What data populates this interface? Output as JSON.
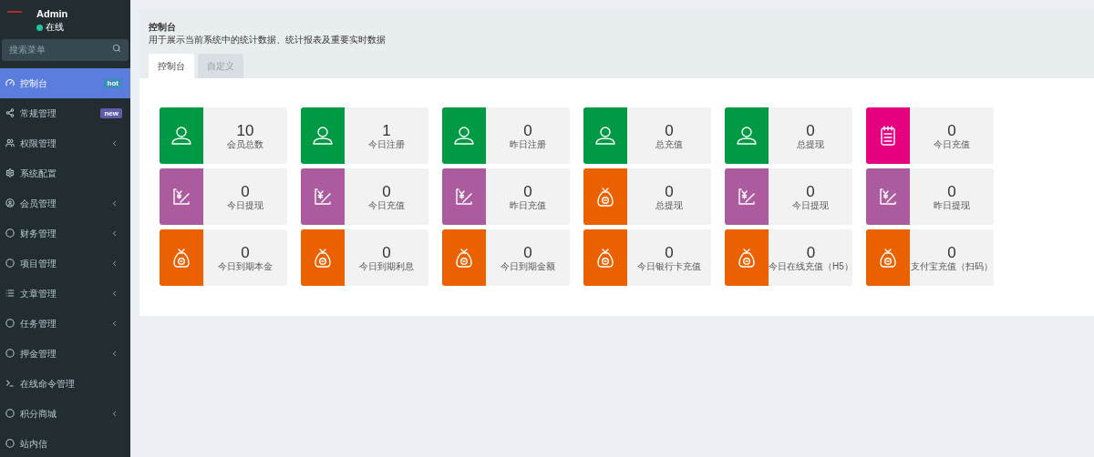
{
  "user": {
    "name": "Admin",
    "status": "在线"
  },
  "search": {
    "placeholder": "搜索菜单"
  },
  "menu": [
    {
      "label": "控制台",
      "kind": "dashboard",
      "selected": true,
      "badge": {
        "text": "hot",
        "color": "#3c8dbc"
      },
      "has_submenu": false
    },
    {
      "label": "常规管理",
      "kind": "cogs",
      "selected": false,
      "badge": {
        "text": "new",
        "color": "#605ca8"
      },
      "has_submenu": false
    },
    {
      "label": "权限管理",
      "kind": "group",
      "selected": false,
      "has_submenu": true
    },
    {
      "label": "系统配置",
      "kind": "gear",
      "selected": false,
      "has_submenu": false
    },
    {
      "label": "会员管理",
      "kind": "user",
      "selected": false,
      "has_submenu": true
    },
    {
      "label": "财务管理",
      "kind": "circle",
      "selected": false,
      "has_submenu": true
    },
    {
      "label": "项目管理",
      "kind": "circle",
      "selected": false,
      "has_submenu": true
    },
    {
      "label": "文章管理",
      "kind": "list",
      "selected": false,
      "has_submenu": true
    },
    {
      "label": "任务管理",
      "kind": "circle",
      "selected": false,
      "has_submenu": true
    },
    {
      "label": "押金管理",
      "kind": "circle",
      "selected": false,
      "has_submenu": true
    },
    {
      "label": "在线命令管理",
      "kind": "terminal",
      "selected": false,
      "has_submenu": false
    },
    {
      "label": "积分商城",
      "kind": "circle",
      "selected": false,
      "has_submenu": true
    },
    {
      "label": "站内信",
      "kind": "circle",
      "selected": false,
      "has_submenu": false
    }
  ],
  "header": {
    "title": "控制台",
    "subtitle": "用于展示当前系统中的统计数据、统计报表及重要实时数据"
  },
  "tabs": [
    {
      "label": "控制台",
      "selected": true
    },
    {
      "label": "自定义",
      "selected": false
    }
  ],
  "stats": [
    {
      "value": "10",
      "label": "会员总数",
      "kind": "user",
      "color": "#009a45"
    },
    {
      "value": "1",
      "label": "今日注册",
      "kind": "user",
      "color": "#009a45"
    },
    {
      "value": "0",
      "label": "昨日注册",
      "kind": "user",
      "color": "#009a45"
    },
    {
      "value": "0",
      "label": "总充值",
      "kind": "user",
      "color": "#009a45"
    },
    {
      "value": "0",
      "label": "总提现",
      "kind": "user",
      "color": "#009a45"
    },
    {
      "value": "0",
      "label": "今日充值",
      "kind": "notepad",
      "color": "#e4007f"
    },
    {
      "value": "0",
      "label": "今日提现",
      "kind": "yuan",
      "color": "#ac5b9e"
    },
    {
      "value": "0",
      "label": "今日充值",
      "kind": "yuan",
      "color": "#ac5b9e"
    },
    {
      "value": "0",
      "label": "昨日充值",
      "kind": "yuan",
      "color": "#ac5b9e"
    },
    {
      "value": "0",
      "label": "总提现",
      "kind": "bag",
      "color": "#eb6100"
    },
    {
      "value": "0",
      "label": "今日提现",
      "kind": "yuan",
      "color": "#ac5b9e"
    },
    {
      "value": "0",
      "label": "昨日提现",
      "kind": "yuan",
      "color": "#ac5b9e"
    },
    {
      "value": "0",
      "label": "今日到期本金",
      "kind": "bag",
      "color": "#eb6100"
    },
    {
      "value": "0",
      "label": "今日到期利息",
      "kind": "bag",
      "color": "#eb6100"
    },
    {
      "value": "0",
      "label": "今日到期金额",
      "kind": "bag",
      "color": "#eb6100"
    },
    {
      "value": "0",
      "label": "今日银行卡充值",
      "kind": "bag",
      "color": "#eb6100"
    },
    {
      "value": "0",
      "label": "今日在线充值（H5）",
      "kind": "bag",
      "color": "#eb6100"
    },
    {
      "value": "0",
      "label": "支付宝充值（扫码）",
      "kind": "bag",
      "color": "#eb6100"
    }
  ]
}
